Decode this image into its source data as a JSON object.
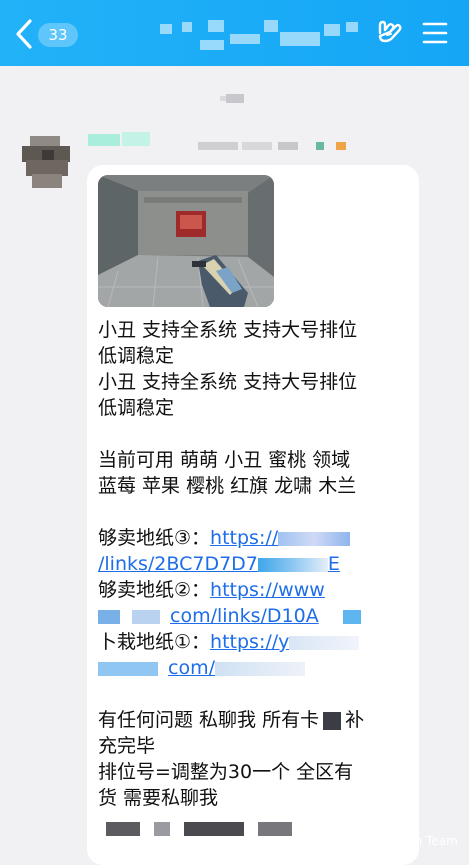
{
  "header": {
    "unread_count": "33"
  },
  "icons": {
    "back": "chevron-left-icon",
    "hand": "hand-gesture-icon",
    "menu": "hamburger-menu-icon"
  },
  "colors": {
    "header": "#1aaaf6",
    "link": "#1d6ee8",
    "background": "#f1f1f3",
    "bubble": "#ffffff"
  },
  "message": {
    "lines": [
      "小丑 支持全系统 支持大号排位",
      "低调稳定",
      "小丑 支持全系统 支持大号排位",
      "低调稳定",
      "",
      "当前可用 萌萌 小丑 蜜桃 领域",
      "蓝莓 苹果 樱桃 红旗 龙啸 木兰",
      ""
    ],
    "links": [
      {
        "label": "够卖地纸③：",
        "url_line1": "https://",
        "url_line2": "/links/2BC7D7D7",
        "url_tail": "E"
      },
      {
        "label": "够卖地纸②：",
        "url_line1": "https://www",
        "url_line2": "com/links/D10A"
      },
      {
        "label": "卜栽地纸①：",
        "url_line1": "https://y",
        "url_line2": "com/"
      }
    ],
    "closing": [
      "有任何问题 私聊我 所有卡",
      "补",
      "充完毕",
      "排位号=调整为30一个 全区有",
      "货 需要私聊我"
    ]
  },
  "watermark": {
    "text": "Admin Team"
  }
}
